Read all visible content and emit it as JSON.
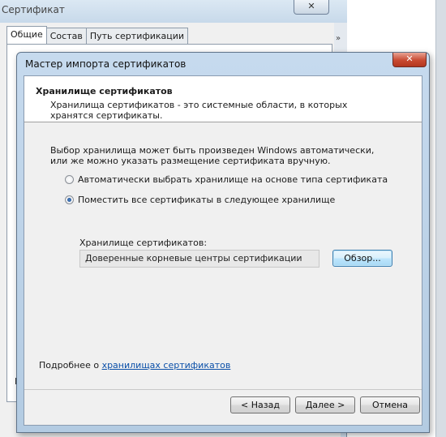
{
  "background_window": {
    "title": "Сертификат",
    "close_glyph": "✕",
    "tabs": [
      {
        "label": "Общие",
        "active": true
      },
      {
        "label": "Состав",
        "active": false
      },
      {
        "label": "Путь сертификации",
        "active": false
      }
    ],
    "scroll_arrow": "»",
    "stub_text": "П"
  },
  "wizard": {
    "title": "Мастер импорта сертификатов",
    "close_glyph": "✕",
    "header": {
      "title": "Хранилище сертификатов",
      "description": "Хранилища сертификатов - это системные области, в которых хранятся сертификаты."
    },
    "intro": "Выбор хранилища может быть произведен Windows автоматически, или же можно указать размещение сертификата вручную.",
    "options": [
      {
        "label": "Автоматически выбрать хранилище на основе типа сертификата",
        "checked": false
      },
      {
        "label": "Поместить все сертификаты в следующее хранилище",
        "checked": true
      }
    ],
    "store_label": "Хранилище сертификатов:",
    "store_value": "Доверенные корневые центры сертификации",
    "browse_label": "Обзор...",
    "more_prefix": "Подробнее о ",
    "more_link": "хранилищах сертификатов",
    "buttons": {
      "back": "< Назад",
      "next": "Далее >",
      "cancel": "Отмена"
    }
  },
  "colors": {
    "link": "#0a4fa8",
    "close_button": "#c84a32",
    "title_bar": "#c6daee",
    "dialog_body": "#f0f0f0"
  },
  "icons": [
    "close-icon",
    "chevron-right-icon"
  ]
}
